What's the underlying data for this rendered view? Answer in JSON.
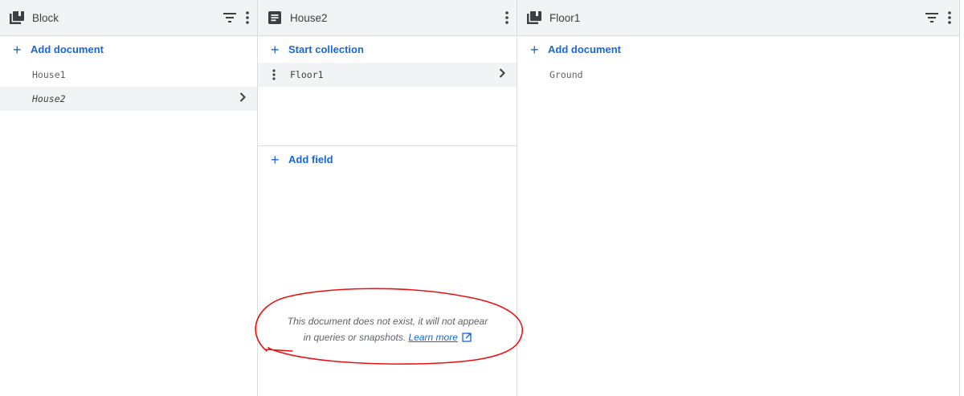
{
  "panels": {
    "block": {
      "title": "Block",
      "add_label": "Add document",
      "documents": [
        {
          "label": "House1",
          "selected": false
        },
        {
          "label": "House2",
          "selected": true
        }
      ]
    },
    "house2": {
      "title": "House2",
      "start_collection_label": "Start collection",
      "collections": [
        {
          "label": "Floor1"
        }
      ],
      "add_field_label": "Add field",
      "notice_line1": "This document does not exist, it will not appear",
      "notice_line2": "in queries or snapshots.",
      "learn_more": "Learn more"
    },
    "floor1": {
      "title": "Floor1",
      "add_label": "Add document",
      "documents": [
        {
          "label": "Ground"
        }
      ]
    }
  },
  "icons": {
    "collection": "collection-icon",
    "document": "document-icon",
    "filter": "filter-icon",
    "more": "more-vert-icon",
    "chevron": "chevron-right-icon",
    "external": "open-in-new-icon"
  },
  "colors": {
    "accent": "#1967d2",
    "header_bg": "#f1f3f4",
    "annotation": "#e8110f"
  }
}
